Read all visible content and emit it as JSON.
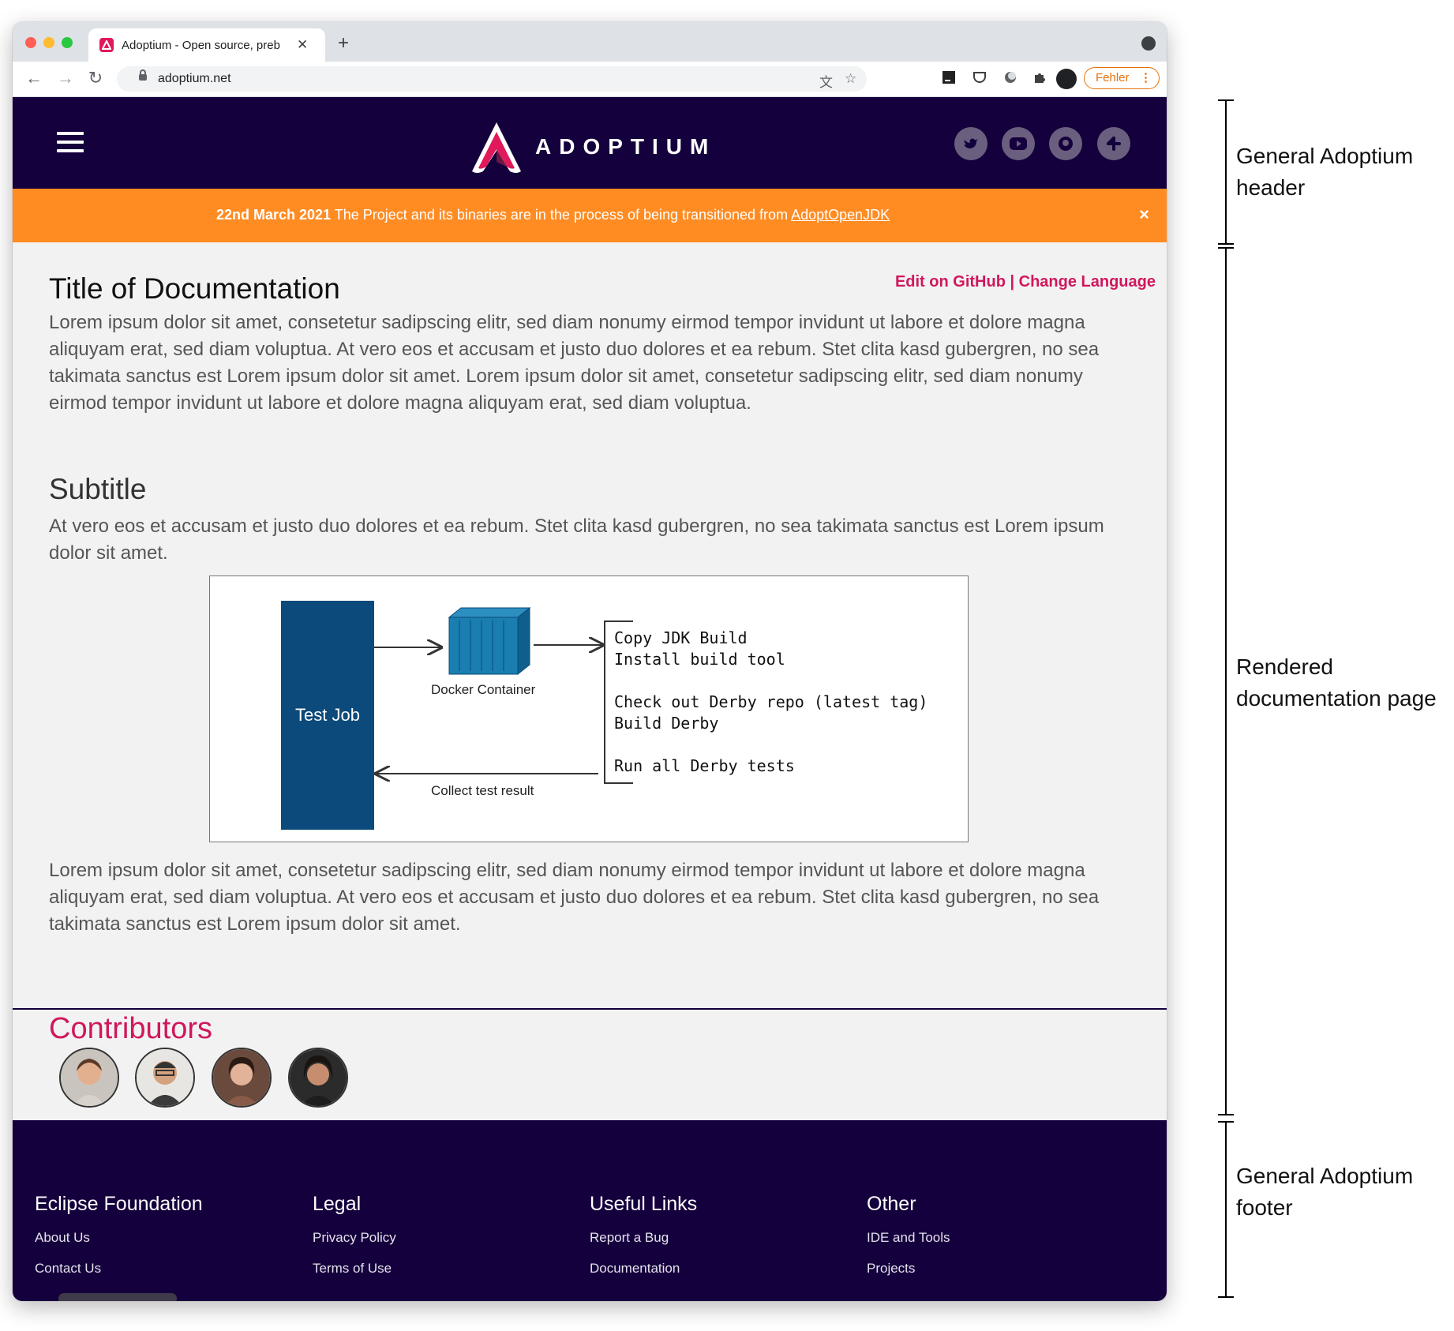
{
  "browser": {
    "tab_title": "Adoptium - Open source, preb",
    "new_tab": "+",
    "close_tab": "✕",
    "url": "adoptium.net",
    "nav": {
      "back": "←",
      "forward": "→",
      "reload": "↻"
    },
    "profile_status": "Fehler",
    "profile_menu": "⋮"
  },
  "header": {
    "logo_text": "ADOPTIUM",
    "social": [
      "twitter-icon",
      "youtube-icon",
      "github-icon",
      "slack-icon"
    ],
    "colors": {
      "background": "#14003c",
      "accent": "#d0175d"
    }
  },
  "banner": {
    "date": "22nd March 2021",
    "text": " The Project and its binaries are in the process of being transitioned from ",
    "link": "AdoptOpenJDK",
    "close": "×",
    "color": "#ff8c23"
  },
  "doc": {
    "title": "Title of Documentation",
    "edit_on_github": "Edit on GitHub",
    "separator": " | ",
    "change_language": "Change Language",
    "para1": "Lorem ipsum dolor sit amet, consetetur sadipscing elitr, sed diam nonumy eirmod tempor invidunt ut labore et dolore magna aliquyam erat, sed diam voluptua. At vero eos et accusam et justo duo dolores et ea rebum. Stet clita kasd gubergren, no sea takimata sanctus est Lorem ipsum dolor sit amet. Lorem ipsum dolor sit amet, consetetur sadipscing elitr, sed diam nonumy eirmod tempor invidunt ut labore et dolore magna aliquyam erat, sed diam voluptua.",
    "subtitle": "Subtitle",
    "para2": "At vero eos et accusam et justo duo dolores et ea rebum. Stet clita kasd gubergren, no sea takimata sanctus est Lorem ipsum dolor sit amet.",
    "para3": "Lorem ipsum dolor sit amet, consetetur sadipscing elitr, sed diam nonumy eirmod tempor invidunt ut labore et dolore magna aliquyam erat, sed diam voluptua. At vero eos et accusam et justo duo dolores et ea rebum. Stet clita kasd gubergren, no sea takimata sanctus est Lorem ipsum dolor sit amet."
  },
  "figure": {
    "test_job": "Test Job",
    "docker_container": "Docker Container",
    "collect_result": "Collect test result",
    "steps": [
      "Copy JDK Build",
      "Install build tool",
      "",
      "Check out Derby repo (latest tag)",
      "Build Derby",
      "",
      "Run all Derby tests"
    ]
  },
  "contributors": {
    "title": "Contributors",
    "count": 4
  },
  "footer": {
    "columns": [
      {
        "heading": "Eclipse Foundation",
        "links": [
          "About Us",
          "Contact Us"
        ]
      },
      {
        "heading": "Legal",
        "links": [
          "Privacy Policy",
          "Terms of Use"
        ]
      },
      {
        "heading": "Useful Links",
        "links": [
          "Report a Bug",
          "Documentation"
        ]
      },
      {
        "heading": "Other",
        "links": [
          "IDE and Tools",
          "Projects"
        ]
      }
    ]
  },
  "annotations": {
    "header": "General Adoptium header",
    "page": "Rendered documentation page",
    "footer": "General Adoptium footer"
  }
}
